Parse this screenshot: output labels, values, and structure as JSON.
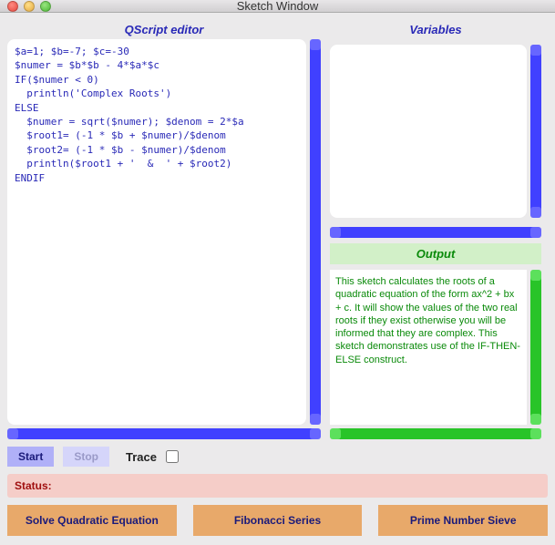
{
  "window": {
    "title": "Sketch Window"
  },
  "editor": {
    "header": "QScript editor",
    "code": "$a=1; $b=-7; $c=-30\n$numer = $b*$b - 4*$a*$c\nIF($numer < 0)\n  println('Complex Roots')\nELSE\n  $numer = sqrt($numer); $denom = 2*$a\n  $root1= (-1 * $b + $numer)/$denom\n  $root2= (-1 * $b - $numer)/$denom\n  println($root1 + '  &  ' + $root2)\nENDIF"
  },
  "variables": {
    "header": "Variables"
  },
  "output": {
    "header": "Output",
    "text": "This sketch calculates the roots of a quadratic equation of the form ax^2 + bx + c. It will show the values of the two real roots if they exist otherwise you will  be informed that they are complex. This sketch demonstrates use of the IF-THEN-ELSE construct."
  },
  "controls": {
    "start": "Start",
    "stop": "Stop",
    "trace": "Trace"
  },
  "status": {
    "label": "Status:"
  },
  "buttons": {
    "quad": "Solve Quadratic Equation",
    "fib": "Fibonacci Series",
    "sieve": "Prime Number Sieve"
  }
}
